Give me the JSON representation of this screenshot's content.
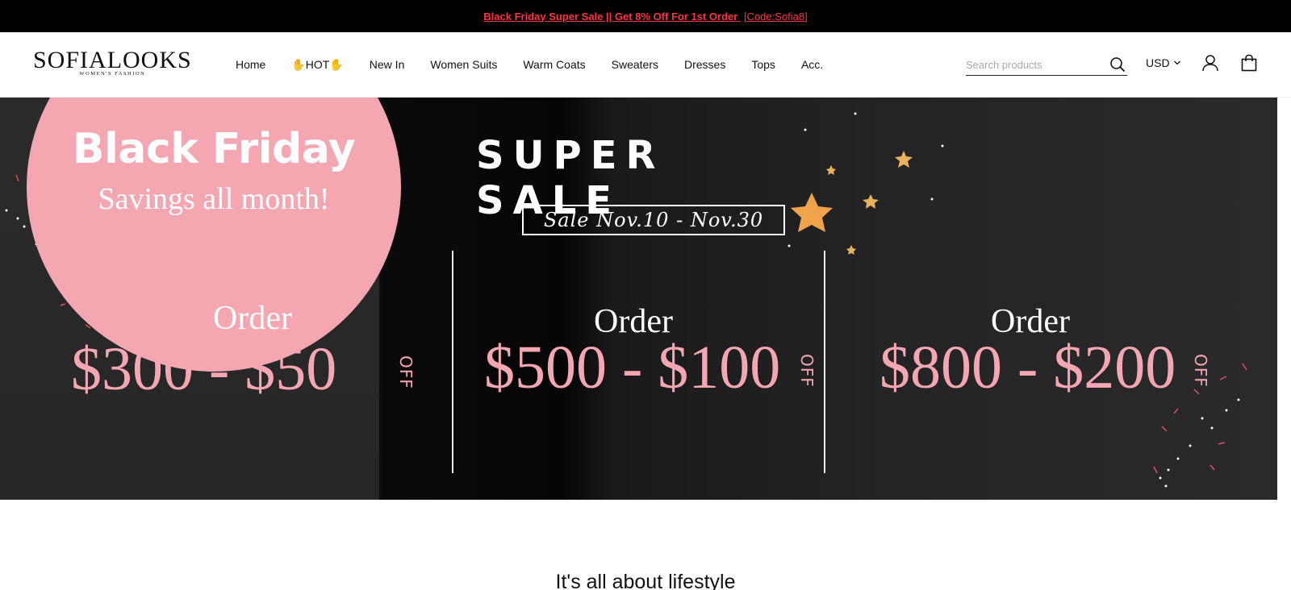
{
  "announcement": {
    "promo_text": "Black Friday Super Sale || Get 8% Off For 1st Order",
    "code_text": "[Code:Sofia8]",
    "color": "#ff3340"
  },
  "header": {
    "logo": {
      "main": "SOFIALOOKS",
      "sub": "WOMEN'S FASHION"
    },
    "nav": [
      {
        "label": "Home"
      },
      {
        "label": "✋HOT✋"
      },
      {
        "label": "New In"
      },
      {
        "label": "Women Suits"
      },
      {
        "label": "Warm Coats"
      },
      {
        "label": "Sweaters"
      },
      {
        "label": "Dresses"
      },
      {
        "label": "Tops"
      },
      {
        "label": "Acc."
      }
    ],
    "search": {
      "placeholder": "Search products",
      "value": "",
      "icon": "search-icon"
    },
    "currency": {
      "selected": "USD",
      "icon": "chevron-down-icon"
    },
    "account_icon": "user-icon",
    "cart_icon": "shopping-bag-icon"
  },
  "hero": {
    "title": "Black Friday",
    "subtitle": "Savings all month!",
    "headline": "SUPER SALE",
    "dates": "Sale Nov.10 - Nov.30",
    "accent_pink": "#f4a6b1",
    "offers": [
      {
        "order": "Order",
        "amount": "$300 - $50",
        "off": "OFF"
      },
      {
        "order": "Order",
        "amount": "$500 - $100",
        "off": "OFF"
      },
      {
        "order": "Order",
        "amount": "$800 - $200",
        "off": "OFF"
      }
    ]
  },
  "section": {
    "heading": "It's all about lifestyle"
  }
}
